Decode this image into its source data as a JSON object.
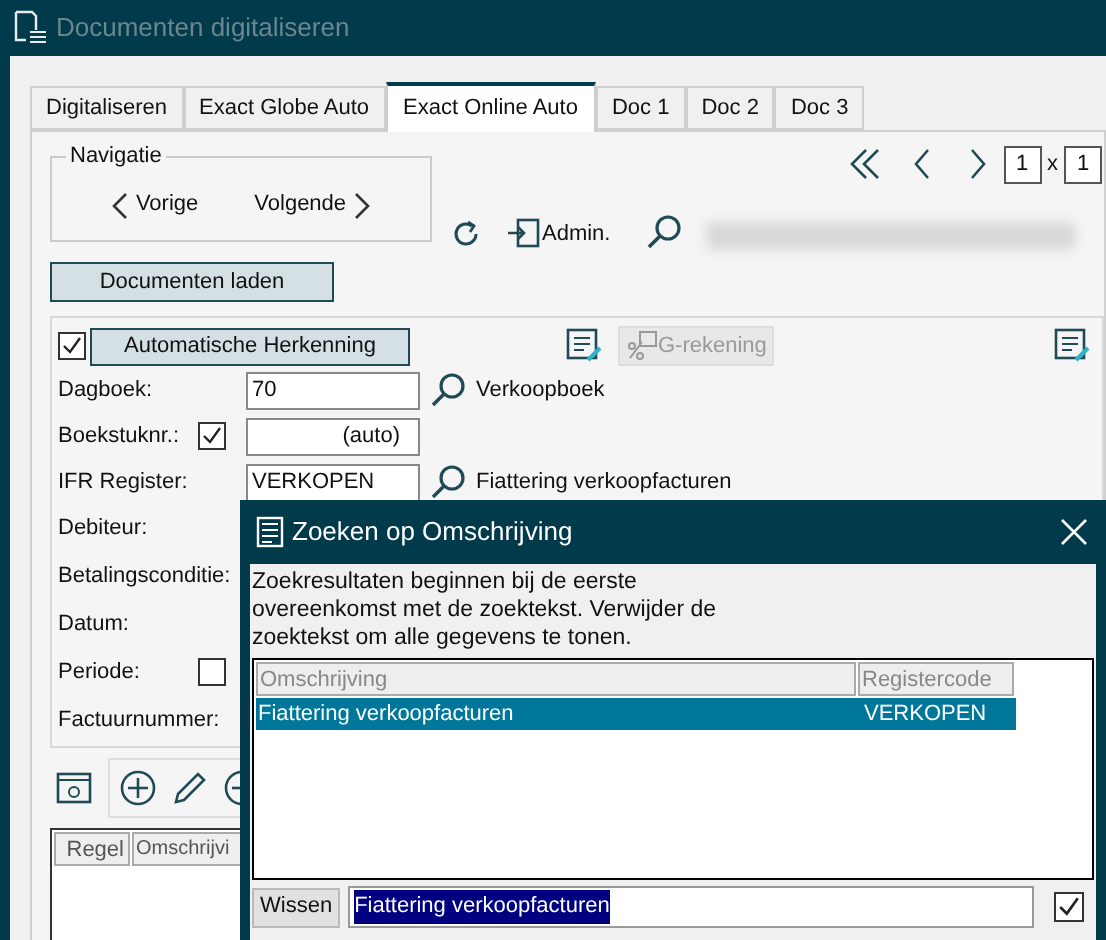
{
  "window": {
    "title": "Documenten digitaliseren"
  },
  "tabs": [
    {
      "label": "Digitaliseren",
      "selected": false
    },
    {
      "label": "Exact Globe Auto",
      "selected": false
    },
    {
      "label": "Exact Online Auto",
      "selected": true
    },
    {
      "label": "Doc 1",
      "selected": false
    },
    {
      "label": "Doc 2",
      "selected": false
    },
    {
      "label": "Doc 3",
      "selected": false
    }
  ],
  "navigation": {
    "title": "Navigatie",
    "previous": "Vorige",
    "next": "Volgende"
  },
  "pager": {
    "page": "1",
    "separator": "x",
    "total": "1"
  },
  "admin_label": "Admin.",
  "load_button": "Documenten laden",
  "auto_recognition": {
    "checked": true,
    "label": "Automatische Herkenning"
  },
  "g_rekening": {
    "label": "G-rekening",
    "disabled": true
  },
  "fields": [
    {
      "kind": "lookup",
      "label": "Dagboek:",
      "value": "70",
      "description": "Verkoopboek"
    },
    {
      "kind": "auto",
      "label": "Boekstuknr.:",
      "checked": true,
      "value": "(auto)"
    },
    {
      "kind": "lookup",
      "label": "IFR Register:",
      "value": "VERKOPEN",
      "description": "Fiattering verkoopfacturen"
    },
    {
      "kind": "plain",
      "label": "Debiteur:"
    },
    {
      "kind": "plain",
      "label": "Betalingsconditie:"
    },
    {
      "kind": "plain",
      "label": "Datum:"
    },
    {
      "kind": "check",
      "label": "Periode:",
      "checked": false
    },
    {
      "kind": "plain",
      "label": "Factuurnummer:"
    }
  ],
  "lines_table": {
    "columns": [
      "Regel",
      "Omschrijvi"
    ]
  },
  "dialog": {
    "title": "Zoeken op Omschrijving",
    "message": "Zoekresultaten beginnen bij de eerste overeenkomst met de zoektekst. Verwijder de zoektekst om alle gegevens te tonen.",
    "columns": [
      "Omschrijving",
      "Registercode"
    ],
    "rows": [
      {
        "cells": [
          "Fiattering verkoopfacturen",
          "VERKOPEN"
        ],
        "selected": true
      }
    ],
    "clear_button": "Wissen",
    "search": {
      "value": "Fiattering verkoopfacturen",
      "text_selected": true
    },
    "confirm_checked": true
  }
}
